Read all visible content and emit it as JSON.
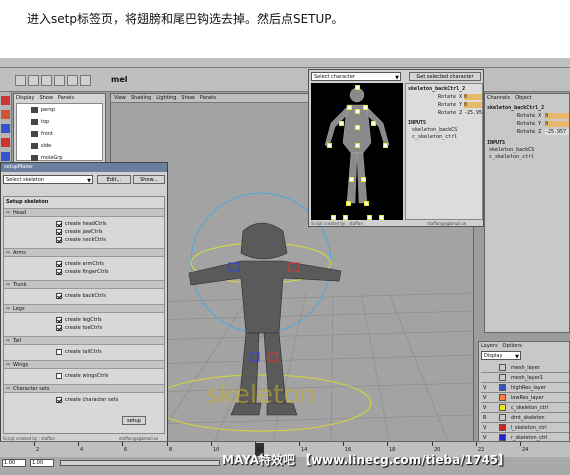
{
  "instruction": "进入setp标签页，将翅膀和尾巴钩选去掉。然后点SETUP。",
  "menu_tabs": [
    "Curves",
    "Surfaces",
    "Polygons",
    "Subdivs",
    "Deformation",
    "Animation",
    "Dynamics",
    "Rendering",
    "PaintEffects",
    "Toons",
    "Cloth",
    "Fluids",
    "Fur",
    "Hair",
    "Custom"
  ],
  "shelf_label": "mel",
  "outliner": {
    "menu": [
      "Display",
      "Show",
      "Panels"
    ],
    "items": [
      "persp",
      "top",
      "front",
      "side",
      "moleGrp"
    ]
  },
  "viewport": {
    "menu": [
      "View",
      "Shading",
      "Lighting",
      "Show",
      "Panels"
    ],
    "camera_label": "persp",
    "ground_text": "skeleton"
  },
  "picker": {
    "select_label": "Select character",
    "button": "Get selected character",
    "footer_left": "Script created by : staffan",
    "footer_right": "staffan@sgbmail.se"
  },
  "picker_attr": {
    "node": "skeleton_backCtrl_2",
    "rows": [
      {
        "label": "Rotate X",
        "value": "0"
      },
      {
        "label": "Rotate Y",
        "value": "0"
      },
      {
        "label": "Rotate Z",
        "value": "-25.957"
      }
    ],
    "inputs_header": "INPUTS",
    "inputs": [
      "skeleton_backCS",
      "c_skeleton_ctrl"
    ]
  },
  "channelbox": {
    "menu": [
      "Channels",
      "Object"
    ],
    "node": "skeleton_backCtrl_2",
    "rows": [
      {
        "label": "Rotate X",
        "value": "0"
      },
      {
        "label": "Rotate Y",
        "value": "0"
      },
      {
        "label": "Rotate Z",
        "value": "-25.957"
      }
    ],
    "inputs_header": "INPUTS",
    "inputs": [
      "skeleton_backCS",
      "c_skeleton_ctrl"
    ]
  },
  "setup_window": {
    "title": "setupMaker",
    "select_label": "Select skeleton",
    "edit_button": "Edit...",
    "show_button": "Show...",
    "tabs": [
      "skeleton",
      "skinning",
      "setup"
    ],
    "heading": "Setup skeleton",
    "sections": [
      {
        "name": "Head",
        "items": [
          {
            "label": "create headCtrls",
            "checked": true
          },
          {
            "label": "create jawCtrls",
            "checked": true
          },
          {
            "label": "create neckCtrls",
            "checked": true
          }
        ]
      },
      {
        "name": "Arms",
        "items": [
          {
            "label": "create armCtrls",
            "checked": true
          },
          {
            "label": "create fingerCtrls",
            "checked": true
          }
        ]
      },
      {
        "name": "Trunk",
        "items": [
          {
            "label": "create backCtrls",
            "checked": true
          }
        ]
      },
      {
        "name": "Legs",
        "items": [
          {
            "label": "create legCtrls",
            "checked": true
          },
          {
            "label": "create toeCtrls",
            "checked": true
          }
        ]
      },
      {
        "name": "Tail",
        "items": [
          {
            "label": "create tailCtrls",
            "checked": false
          }
        ]
      },
      {
        "name": "Wings",
        "items": [
          {
            "label": "create wingsCtrls",
            "checked": false
          }
        ]
      },
      {
        "name": "Character sets",
        "items": [
          {
            "label": "create character sets",
            "checked": true
          }
        ]
      }
    ],
    "setup_button": "setup",
    "footer_left": "Script created by : staffan",
    "footer_right": "staffan@sgbmail.se"
  },
  "layers": {
    "menu": [
      "Layers",
      "Options"
    ],
    "dropdown": "Display",
    "rows": [
      {
        "flag": "",
        "name": "mesh_layer",
        "color": "#c9c9c9"
      },
      {
        "flag": "",
        "name": "mesh_layer1",
        "color": "#c9c9c9"
      },
      {
        "flag": "V",
        "name": "highRes_layer",
        "color": "#3355cc"
      },
      {
        "flag": "V",
        "name": "lowRes_layer",
        "color": "#ff8040"
      },
      {
        "flag": "V",
        "name": "c_skeleton_ctrl",
        "color": "#e6e622"
      },
      {
        "flag": "R",
        "name": "dmt_skeleton",
        "color": "#c9c9c9"
      },
      {
        "flag": "V",
        "name": "l_skeleton_ctrl",
        "color": "#cc2222"
      },
      {
        "flag": "V",
        "name": "r_skeleton_ctrl",
        "color": "#2222cc"
      }
    ]
  },
  "timeline_ticks": [
    "2",
    "4",
    "6",
    "8",
    "10",
    "12",
    "14",
    "16",
    "18",
    "20",
    "22",
    "24"
  ],
  "range": {
    "start": "1.00",
    "end": "24.00",
    "end2": "48.00"
  },
  "watermark": "MAYA特效吧 【www.linecg.com/tieba/1745】",
  "colors": {
    "maya_bg": "#9c9c9c",
    "viewport": "#a3a3a3",
    "highlight": "#e8b86a"
  }
}
